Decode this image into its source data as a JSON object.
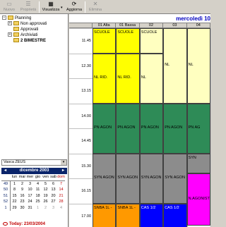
{
  "toolbar": {
    "buttons": [
      {
        "label": "Nuovo",
        "icon": "new-icon",
        "enabled": false
      },
      {
        "label": "Proprietà",
        "icon": "properties-icon",
        "enabled": false
      },
      {
        "label": "Visualizza",
        "icon": "view-icon",
        "enabled": true
      },
      {
        "label": "Aggiorna",
        "icon": "refresh-icon",
        "enabled": true
      },
      {
        "label": "Elimina",
        "icon": "delete-icon",
        "enabled": false
      }
    ]
  },
  "tree": {
    "items": [
      {
        "label": "Planning",
        "level": 0,
        "expanded": true
      },
      {
        "label": "Non approvati",
        "level": 1
      },
      {
        "label": "Approvati",
        "level": 1
      },
      {
        "label": "Archiviati",
        "level": 1
      },
      {
        "label": "2 BIMESTRE",
        "level": 1,
        "bold": true
      }
    ]
  },
  "room_select": {
    "value": "Vasca ZEUS"
  },
  "calendar": {
    "month_label": "dicembre 2003",
    "dow": [
      "lun",
      "mar",
      "mer",
      "gio",
      "ven",
      "sab",
      "dom"
    ],
    "weeks": [
      {
        "wk": "49",
        "days": [
          "1",
          "2",
          "3",
          "4",
          "5",
          "6",
          "7"
        ]
      },
      {
        "wk": "50",
        "days": [
          "8",
          "9",
          "10",
          "11",
          "12",
          "13",
          "14"
        ]
      },
      {
        "wk": "51",
        "days": [
          "15",
          "16",
          "17",
          "18",
          "19",
          "20",
          "21"
        ]
      },
      {
        "wk": "52",
        "days": [
          "22",
          "23",
          "24",
          "25",
          "26",
          "27",
          "28"
        ]
      },
      {
        "wk": "1",
        "days": [
          "29",
          "30",
          "31",
          "1",
          "2",
          "3",
          "4"
        ]
      }
    ],
    "today_label": "Today: 23/03/2004"
  },
  "schedule": {
    "date_title": "mercoledì 10",
    "columns": [
      "01 Alta",
      "01 Bassa",
      "02",
      "03",
      "04"
    ],
    "hours": [
      "11.45",
      "12.30",
      "13.15",
      "14.00",
      "14.45",
      "15.30",
      "16.15",
      "17.00"
    ],
    "events": [
      {
        "col": 0,
        "start": 0,
        "end": 1,
        "label": "SCUOLE",
        "color": "#ffff00"
      },
      {
        "col": 1,
        "start": 0,
        "end": 1,
        "label": "SCUOLE",
        "color": "#ffff00"
      },
      {
        "col": 2,
        "start": 0,
        "end": 1,
        "label": "SCUOLE",
        "color": "#ffffc0"
      },
      {
        "col": 0,
        "start": 1,
        "end": 3,
        "label": "NL RID.",
        "color": "#ffff00"
      },
      {
        "col": 1,
        "start": 1,
        "end": 3,
        "label": "NL RID.",
        "color": "#ffff00"
      },
      {
        "col": 2,
        "start": 1,
        "end": 3,
        "label": "NL",
        "color": "#ffffc0"
      },
      {
        "col": 3,
        "start": 0,
        "end": 3,
        "label": "NL",
        "color": "#ffffc0"
      },
      {
        "col": 4,
        "start": 0,
        "end": 3,
        "label": "NL",
        "color": "#ffffc0"
      },
      {
        "col": 0,
        "start": 3,
        "end": 5,
        "label": "PN AGON",
        "color": "#2e8b57"
      },
      {
        "col": 1,
        "start": 3,
        "end": 5,
        "label": "PN AGON",
        "color": "#2e8b57"
      },
      {
        "col": 2,
        "start": 3,
        "end": 5,
        "label": "PN AGON",
        "color": "#2e8b57"
      },
      {
        "col": 3,
        "start": 3,
        "end": 5,
        "label": "PN AGON",
        "color": "#2e8b57"
      },
      {
        "col": 4,
        "start": 3,
        "end": 5,
        "label": "PN AG",
        "color": "#2e8b57"
      },
      {
        "col": 0,
        "start": 5,
        "end": 7,
        "label": "SYN AGON",
        "color": "#8c8c8c"
      },
      {
        "col": 1,
        "start": 5,
        "end": 7,
        "label": "SYN AGON",
        "color": "#8c8c8c"
      },
      {
        "col": 2,
        "start": 5,
        "end": 7,
        "label": "SYN AGON",
        "color": "#8c8c8c"
      },
      {
        "col": 3,
        "start": 5,
        "end": 7,
        "label": "SYN AGON",
        "color": "#8c8c8c"
      },
      {
        "col": 4,
        "start": 5,
        "end": 5.8,
        "label": "SYN",
        "color": "#8c8c8c"
      },
      {
        "col": 4,
        "start": 5.8,
        "end": 7.9,
        "label": "N.AGONIST",
        "color": "#ff00ff"
      },
      {
        "col": 0,
        "start": 7,
        "end": 8,
        "label": "SNBA 1L -",
        "color": "#ff9900"
      },
      {
        "col": 1,
        "start": 7,
        "end": 8,
        "label": "SNBA 1L -",
        "color": "#ff9900"
      },
      {
        "col": 2,
        "start": 7,
        "end": 8,
        "label": "CAS 1/2",
        "color": "#0000ff",
        "text_color": "#ffffff"
      },
      {
        "col": 3,
        "start": 7,
        "end": 8,
        "label": "CAS 1/2",
        "color": "#0000ff",
        "text_color": "#ffffff"
      }
    ]
  }
}
